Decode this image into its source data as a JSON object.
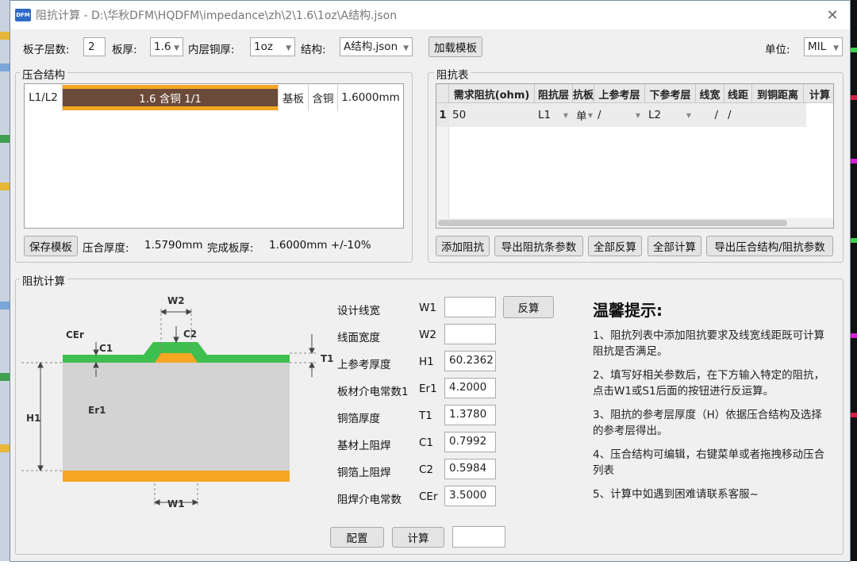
{
  "window": {
    "icon_text": "DFM",
    "title": "阻抗计算 - D:\\华秋DFM\\HQDFM\\impedance\\zh\\2\\1.6\\1oz\\A结构.json",
    "close_glyph": "✕"
  },
  "toolbar": {
    "layers_label": "板子层数:",
    "layers_value": "2",
    "thickness_label": "板厚:",
    "thickness_value": "1.6",
    "inner_copper_label": "内层铜厚:",
    "inner_copper_value": "1oz",
    "structure_label": "结构:",
    "structure_value": "A结构.json",
    "load_template": "加载模板",
    "unit_label": "单位:",
    "unit_value": "MIL"
  },
  "stackup": {
    "title": "压合结构",
    "row": {
      "layer": "L1/L2",
      "core_text": "1.6 含铜 1/1",
      "type": "基板",
      "copper": "含铜",
      "thickness": "1.6000mm"
    },
    "save_template": "保存模板",
    "press_label": "压合厚度:",
    "press_value": "1.5790mm",
    "finish_label": "完成板厚:",
    "finish_value": "1.6000mm +/-10%"
  },
  "impedance_table": {
    "title": "阻抗表",
    "headers": [
      "需求阻抗(ohm)",
      "阻抗层",
      "抗板",
      "上参考层",
      "下参考层",
      "线宽",
      "线距",
      "到铜距离",
      "计算"
    ],
    "row": {
      "num": "1",
      "impedance": "50",
      "layer": "L1",
      "type": "单",
      "upper_ref": "/",
      "lower_ref": "L2",
      "width": "/",
      "spacing": "/"
    },
    "buttons": {
      "add": "添加阻抗",
      "export": "导出阻抗条参数",
      "reverse_all": "全部反算",
      "calc_all": "全部计算",
      "export_stack": "导出压合结构/阻抗参数"
    }
  },
  "calc": {
    "title": "阻抗计算",
    "diagram": {
      "W2": "W2",
      "C2": "C2",
      "CEr": "CEr",
      "C1": "C1",
      "T1": "T1",
      "H1": "H1",
      "Er1": "Er1",
      "W1": "W1"
    },
    "params": [
      {
        "label": "设计线宽",
        "sym": "W1",
        "value": ""
      },
      {
        "label": "线面宽度",
        "sym": "W2",
        "value": ""
      },
      {
        "label": "上参考厚度",
        "sym": "H1",
        "value": "60.2362"
      },
      {
        "label": "板材介电常数1",
        "sym": "Er1",
        "value": "4.2000"
      },
      {
        "label": "铜箔厚度",
        "sym": "T1",
        "value": "1.3780"
      },
      {
        "label": "基材上阻焊",
        "sym": "C1",
        "value": "0.7992"
      },
      {
        "label": "铜箔上阻焊",
        "sym": "C2",
        "value": "0.5984"
      },
      {
        "label": "阻焊介电常数",
        "sym": "CEr",
        "value": "3.5000"
      }
    ],
    "reverse_button": "反算",
    "config_button": "配置",
    "calc_button": "计算",
    "result": ""
  },
  "tips": {
    "title": "温馨提示:",
    "items": [
      "1、阻抗列表中添加阻抗要求及线宽线距既可计算阻抗是否满足。",
      "2、填写好相关参数后，在下方输入特定的阻抗，点击W1或S1后面的按钮进行反运算。",
      "3、阻抗的参考层厚度（H）依据压合结构及选择的参考层得出。",
      "4、压合结构可编辑，右键菜单或者拖拽移动压合列表",
      "5、计算中如遇到困难请联系客服~"
    ]
  },
  "colors": {
    "solder_mask": "#3fbf4f",
    "copper": "#f5a623",
    "substrate": "#d3d3d3",
    "core_fill": "#6b4a3a"
  }
}
